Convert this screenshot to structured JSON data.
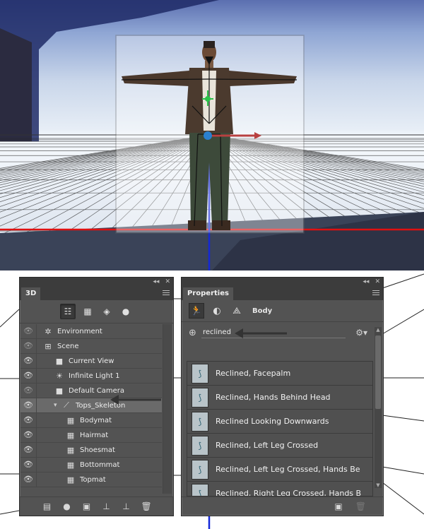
{
  "panel_3d": {
    "title": "3D",
    "filters": [
      {
        "name": "scene-filter-icon",
        "glyph": "☷",
        "active": true
      },
      {
        "name": "mesh-filter-icon",
        "glyph": "▦",
        "active": false
      },
      {
        "name": "material-filter-icon",
        "glyph": "◈",
        "active": false
      },
      {
        "name": "light-filter-icon",
        "glyph": "●",
        "active": false
      }
    ],
    "layers": [
      {
        "label": "Environment",
        "icon": "✲",
        "indent": 0
      },
      {
        "label": "Scene",
        "icon": "⊞",
        "indent": 0
      },
      {
        "label": "Current View",
        "icon": "■",
        "indent": 1
      },
      {
        "label": "Infinite Light 1",
        "icon": "☀",
        "indent": 1
      },
      {
        "label": "Default Camera",
        "icon": "■",
        "indent": 1
      },
      {
        "label": "Tops_Skeleton",
        "icon": "⟋",
        "indent": 1
      },
      {
        "label": "Bodymat",
        "icon": "▦",
        "indent": 2
      },
      {
        "label": "Hairmat",
        "icon": "▦",
        "indent": 2
      },
      {
        "label": "Shoesmat",
        "icon": "▦",
        "indent": 2
      },
      {
        "label": "Bottommat",
        "icon": "▦",
        "indent": 2
      },
      {
        "label": "Topmat",
        "icon": "▦",
        "indent": 2
      }
    ],
    "bottom_icons": [
      "▤",
      "●",
      "▣",
      "⊥",
      "⊥",
      "🗑"
    ]
  },
  "panel_props": {
    "title": "Properties",
    "section_label": "Body",
    "search": {
      "value": "reclined"
    },
    "poses": [
      "Reclined, Facepalm",
      "Reclined, Hands Behind Head",
      "Reclined Looking Downwards",
      "Reclined, Left Leg Crossed",
      "Reclined, Left Leg Crossed, Hands Be",
      "Reclined, Right Leg Crossed, Hands B"
    ]
  },
  "colors": {
    "panel_bg": "#535353",
    "dark_bar": "#3c3c3c",
    "axis_red": "#e01010",
    "axis_blue": "#1428d8"
  }
}
